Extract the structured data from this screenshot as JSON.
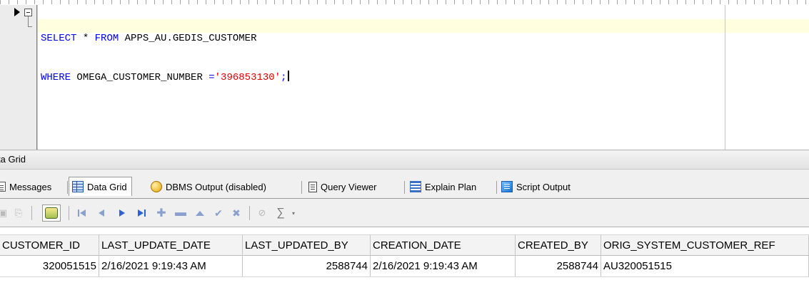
{
  "editor": {
    "line1": {
      "kw1": "SELECT",
      "sym1": " * ",
      "kw2": "FROM",
      "rest": " APPS_AU.GEDIS_CUSTOMER"
    },
    "line2": {
      "kw1": "WHERE",
      "rest": " OMEGA_CUSTOMER_NUMBER ",
      "op": "=",
      "str": "'396853130'",
      "end": ";"
    }
  },
  "panel": {
    "title": "ta Grid"
  },
  "tabs": [
    {
      "label": "Messages",
      "icon": "messages-icon"
    },
    {
      "label": "Data Grid",
      "icon": "data-grid-icon"
    },
    {
      "label": "DBMS Output (disabled)",
      "icon": "dbms-output-icon"
    },
    {
      "label": "Query Viewer",
      "icon": "query-viewer-icon"
    },
    {
      "label": "Explain Plan",
      "icon": "explain-plan-icon"
    },
    {
      "label": "Script Output",
      "icon": "script-output-icon"
    }
  ],
  "grid": {
    "columns": [
      "CUSTOMER_ID",
      "LAST_UPDATE_DATE",
      "LAST_UPDATED_BY",
      "CREATION_DATE",
      "CREATED_BY",
      "ORIG_SYSTEM_CUSTOMER_REF"
    ],
    "rows": [
      [
        "320051515",
        "2/16/2021 9:19:43 AM",
        "2588744",
        "2/16/2021 9:19:43 AM",
        "2588744",
        "AU320051515"
      ]
    ]
  },
  "toolbar": {
    "sigma": "∑",
    "dropdown": "▾"
  }
}
